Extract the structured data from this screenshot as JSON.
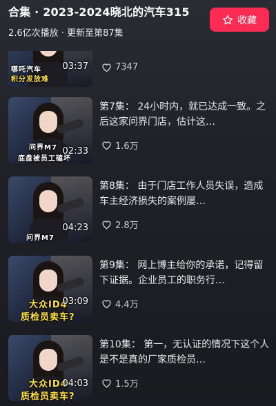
{
  "header": {
    "title": "合集 · 2023-2024晓北的汽车315",
    "subtitle": "2.6亿次播放 · 更新至第87集",
    "favorite_label": "收藏"
  },
  "episodes": [
    {
      "desc": "",
      "likes": "7347",
      "duration": "03:37",
      "caption1": "哪吒汽车",
      "caption2": "积分发放难"
    },
    {
      "desc": "第7集： 24小时内，就已达成一致。之后这家问界门店，估计这…",
      "likes": "1.6万",
      "duration": "02:33",
      "caption1": "问界M7",
      "caption2": "底盘被员工磕坏"
    },
    {
      "desc": "第8集： 由于门店工作人员失误，造成车主经济损失的案例屡…",
      "likes": "2.8万",
      "duration": "04:23",
      "caption1": "问界M7",
      "caption2": ""
    },
    {
      "desc": "第9集： 网上博主给你的承诺，记得留下证据。企业员工的职务行…",
      "likes": "4.4万",
      "duration": "03:09",
      "caption1": "大众ID4",
      "caption2": "质检员卖车?"
    },
    {
      "desc": "第10集： 第一，无认证的情况下这个人是不是真的厂家质检员…",
      "likes": "1.5万",
      "duration": "04:03",
      "caption1": "大众ID4",
      "caption2": "质检员卖车?"
    }
  ],
  "colors": {
    "accent": "#fe2c55",
    "background": "#1f2127"
  }
}
